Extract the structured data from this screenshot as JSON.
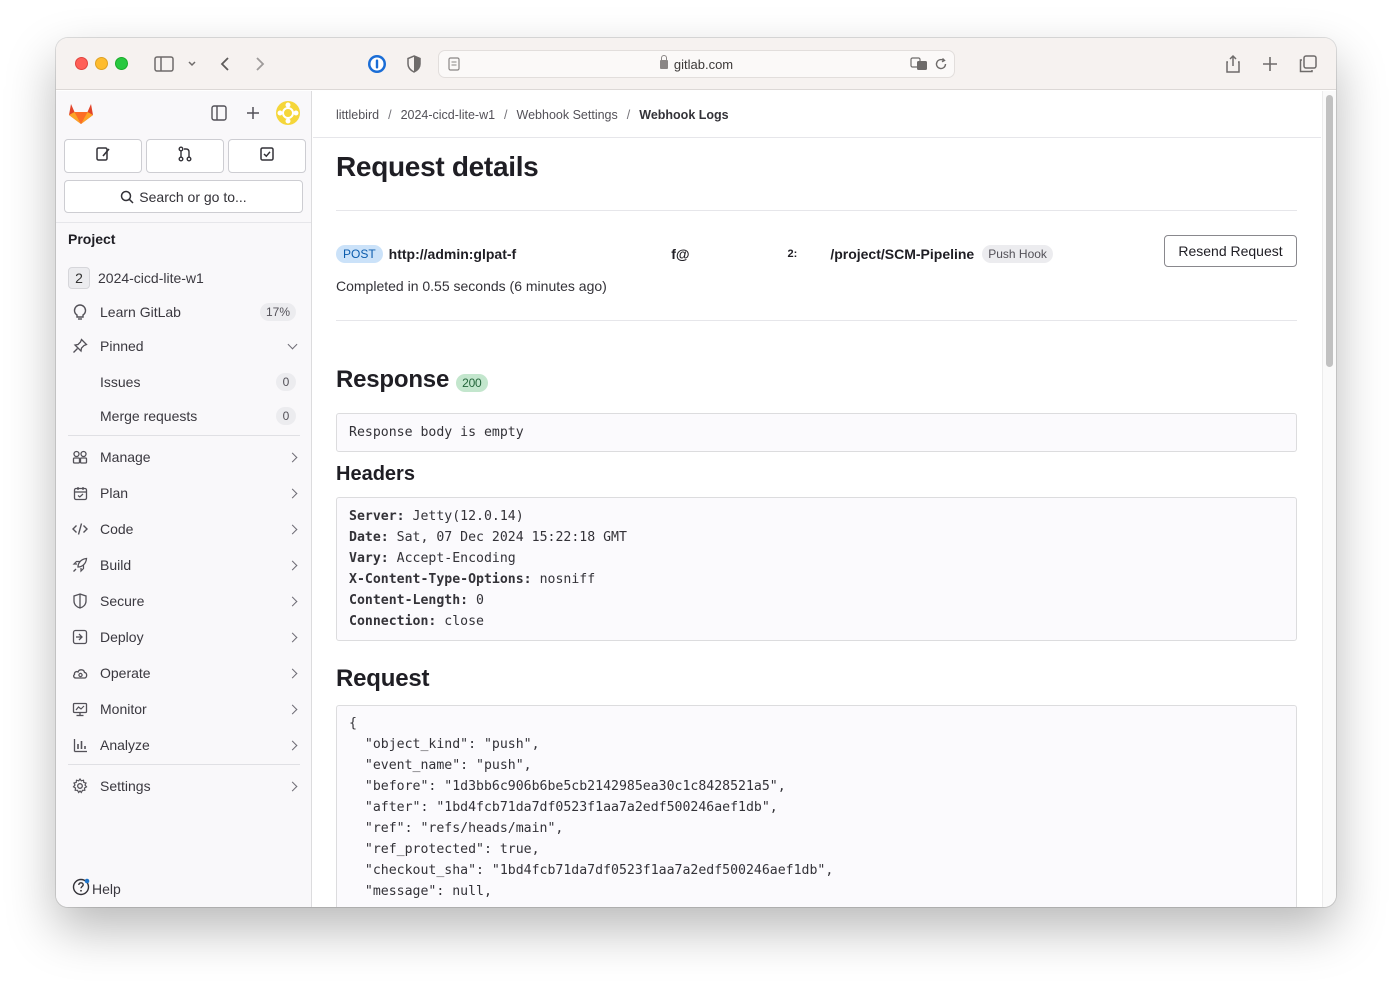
{
  "browser": {
    "url": "gitlab.com"
  },
  "sidebar": {
    "search_placeholder": "Search or go to...",
    "section": "Project",
    "project_avatar": "2",
    "project_name": "2024-cicd-lite-w1",
    "learn": {
      "label": "Learn GitLab",
      "badge": "17%"
    },
    "pinned": {
      "label": "Pinned",
      "items": [
        {
          "label": "Issues",
          "count": "0"
        },
        {
          "label": "Merge requests",
          "count": "0"
        }
      ]
    },
    "nav": [
      {
        "label": "Manage",
        "icon": "users-icon"
      },
      {
        "label": "Plan",
        "icon": "calendar-icon"
      },
      {
        "label": "Code",
        "icon": "code-icon"
      },
      {
        "label": "Build",
        "icon": "rocket-icon"
      },
      {
        "label": "Secure",
        "icon": "shield-icon"
      },
      {
        "label": "Deploy",
        "icon": "deploy-icon"
      },
      {
        "label": "Operate",
        "icon": "cloud-gear-icon"
      },
      {
        "label": "Monitor",
        "icon": "monitor-icon"
      },
      {
        "label": "Analyze",
        "icon": "chart-icon"
      }
    ],
    "settings": "Settings",
    "help": "Help"
  },
  "breadcrumb": [
    "littlebird",
    "2024-cicd-lite-w1",
    "Webhook Settings",
    "Webhook Logs"
  ],
  "page": {
    "title": "Request details",
    "method": "POST",
    "url_part1": "http://admin:glpat-f",
    "url_part2": "f@",
    "url_part3": "2:",
    "url_part4": "/project/SCM-Pipeline",
    "hook_type": "Push Hook",
    "resend_label": "Resend Request",
    "completed": "Completed in 0.55 seconds (6 minutes ago)"
  },
  "response": {
    "heading": "Response",
    "status": "200",
    "body": "Response body is empty"
  },
  "headers": {
    "heading": "Headers",
    "rows": [
      {
        "key": "Server:",
        "value": "Jetty(12.0.14)"
      },
      {
        "key": "Date:",
        "value": "Sat, 07 Dec 2024 15:22:18 GMT"
      },
      {
        "key": "Vary:",
        "value": "Accept-Encoding"
      },
      {
        "key": "X-Content-Type-Options:",
        "value": "nosniff"
      },
      {
        "key": "Content-Length:",
        "value": "0"
      },
      {
        "key": "Connection:",
        "value": "close"
      }
    ]
  },
  "request": {
    "heading": "Request",
    "lines": [
      "{",
      "  \"object_kind\": \"push\",",
      "  \"event_name\": \"push\",",
      "  \"before\": \"1d3bb6c906b6be5cb2142985ea30c1c8428521a5\",",
      "  \"after\": \"1bd4fcb71da7df0523f1aa7a2edf500246aef1db\",",
      "  \"ref\": \"refs/heads/main\",",
      "  \"ref_protected\": true,",
      "  \"checkout_sha\": \"1bd4fcb71da7df0523f1aa7a2edf500246aef1db\",",
      "  \"message\": null,"
    ]
  },
  "colors": {
    "accent_blue": "#1f75cb",
    "status_green": "#24663b",
    "gitlab_orange": "#fc6d26"
  }
}
